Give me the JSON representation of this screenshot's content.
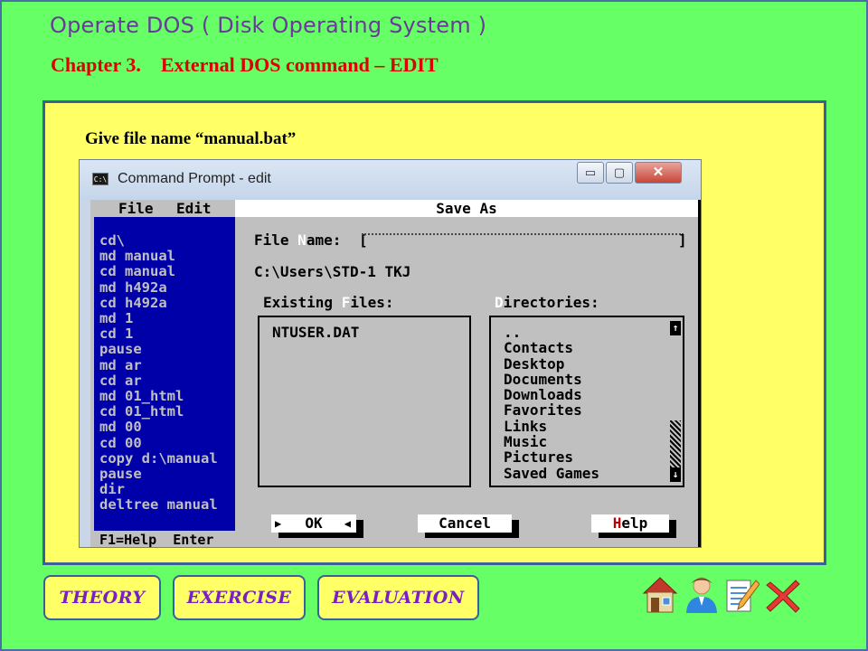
{
  "slide": {
    "title": "Operate DOS ( Disk Operating System )",
    "chapter": "Chapter 3.",
    "chapter_topic": "External DOS command – EDIT",
    "instruction": "Give file name “manual.bat”"
  },
  "window": {
    "icon_text": "C:\\",
    "title": "Command Prompt - edit",
    "min_glyph": "▭",
    "max_glyph": "▢",
    "close_glyph": "✕"
  },
  "dos": {
    "menu": {
      "file": "File",
      "edit": "Edit"
    },
    "lines": [
      "cd\\",
      "md manual",
      "cd manual",
      "md h492a",
      "cd h492a",
      "md 1",
      "cd 1",
      "pause",
      "md ar",
      "cd ar",
      "md 01_html",
      "cd 01_html",
      "md 00",
      "cd 00",
      "copy d:\\manual",
      "pause",
      "dir",
      "deltree manual"
    ],
    "status": "F1=Help  Enter"
  },
  "dialog": {
    "title": "Save As",
    "file_name_label_a": "File ",
    "file_name_label_hot": "N",
    "file_name_label_b": "ame: ",
    "file_name_value": "",
    "current_path": "C:\\Users\\STD-1 TKJ",
    "existing_files_label_a": "Existing ",
    "existing_files_label_hot": "F",
    "existing_files_label_b": "iles:",
    "directories_label_hot": "D",
    "directories_label_b": "irectories:",
    "files": [
      "NTUSER.DAT"
    ],
    "directories": [
      "..",
      "Contacts",
      "Desktop",
      "Documents",
      "Downloads",
      "Favorites",
      "Links",
      "Music",
      "Pictures",
      "Saved Games"
    ],
    "ok_label": "OK",
    "cancel_label": "Cancel",
    "help_label_hot": "H",
    "help_label_b": "elp"
  },
  "nav": {
    "theory": "THEORY",
    "exercise": "EXERCISE",
    "evaluation": "EVALUATION"
  },
  "icons": [
    "home-icon",
    "user-icon",
    "notepad-icon",
    "close-icon"
  ]
}
